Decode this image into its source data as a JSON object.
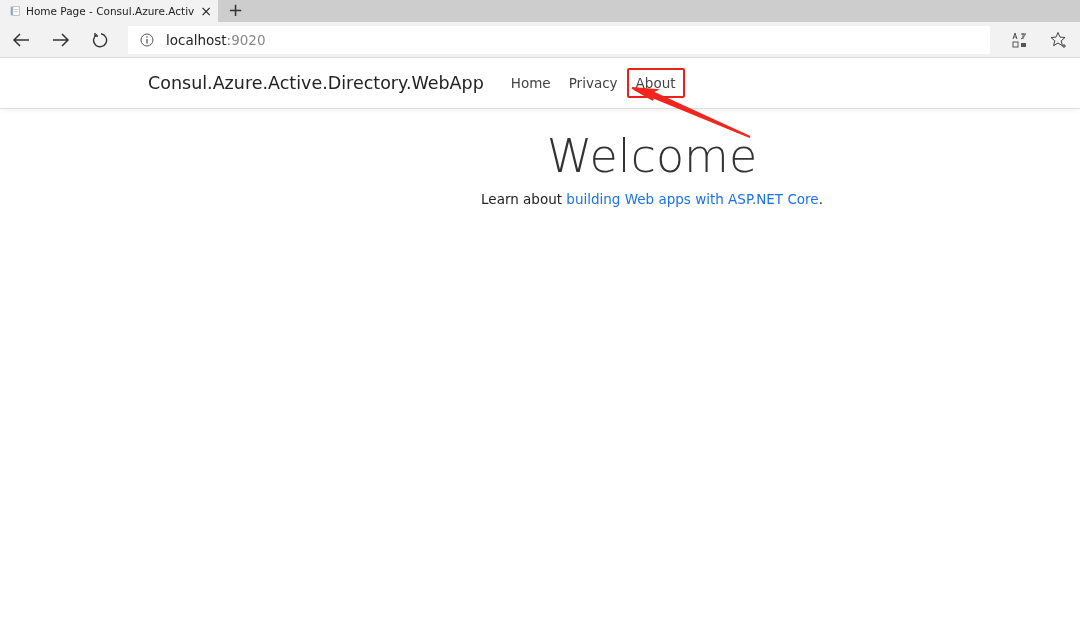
{
  "browser": {
    "tab": {
      "title": "Home Page - Consul.Azure.Activ",
      "close": "×"
    },
    "new_tab": "+",
    "address": {
      "host": "localhost",
      "port": ":9020"
    }
  },
  "navbar": {
    "brand": "Consul.Azure.Active.Directory.WebApp",
    "items": [
      {
        "label": "Home",
        "highlighted": false
      },
      {
        "label": "Privacy",
        "highlighted": false
      },
      {
        "label": "About",
        "highlighted": true
      }
    ]
  },
  "main": {
    "heading": "Welcome",
    "lead": "Learn about ",
    "link": "building Web apps with ASP.NET Core",
    "trail": "."
  }
}
